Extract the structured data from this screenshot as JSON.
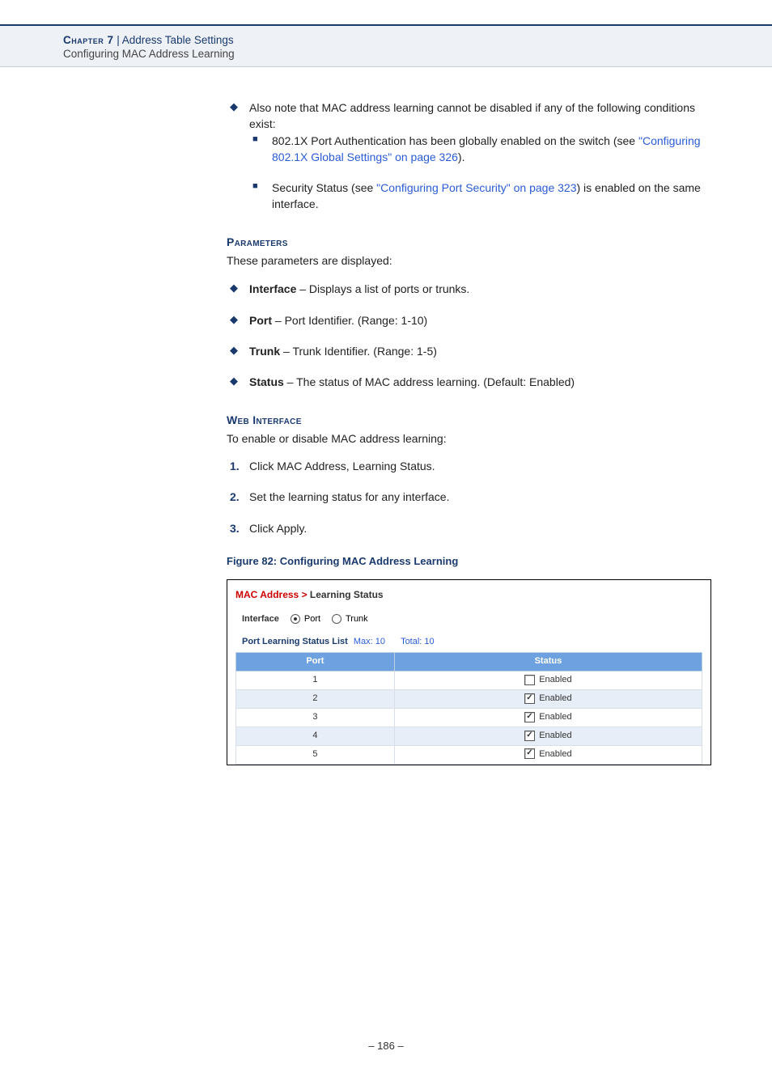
{
  "header": {
    "chapter_label": "Chapter 7",
    "sep": "  |  ",
    "title": "Address Table Settings",
    "subtitle": "Configuring MAC Address Learning"
  },
  "intro": {
    "note_lead": "Also note that MAC address learning cannot be disabled if any of the following conditions exist:",
    "cond1a": "802.1X Port Authentication has been globally enabled on the switch (see ",
    "cond1_link": "\"Configuring 802.1X Global Settings\" on page 326",
    "cond1b": ").",
    "cond2a": "Security Status (see ",
    "cond2_link": "\"Configuring Port Security\" on page 323",
    "cond2b": ") is enabled on the same interface."
  },
  "params": {
    "heading": "Parameters",
    "lead": "These parameters are displayed:",
    "items": [
      {
        "term": "Interface",
        "desc": " – Displays a list of ports or trunks."
      },
      {
        "term": "Port",
        "desc": " – Port Identifier. (Range: 1-10)"
      },
      {
        "term": "Trunk",
        "desc": " – Trunk Identifier. (Range: 1-5)"
      },
      {
        "term": "Status",
        "desc": " – The status of MAC address learning. (Default: Enabled)"
      }
    ]
  },
  "web": {
    "heading": "Web Interface",
    "lead": "To enable or disable MAC address learning:",
    "steps": [
      "Click MAC Address, Learning Status.",
      "Set the learning status for any interface.",
      "Click Apply."
    ]
  },
  "figure": {
    "caption": "Figure 82:  Configuring MAC Address Learning"
  },
  "ui": {
    "bc1": "MAC Address > ",
    "bc2": "Learning Status",
    "interface_label": "Interface",
    "radio_port": "Port",
    "radio_trunk": "Trunk",
    "list_title": "Port Learning Status List",
    "max_label": "Max: 10",
    "total_label": "Total: 10",
    "col_port": "Port",
    "col_status": "Status",
    "enabled_label": "Enabled",
    "rows": [
      {
        "port": "1",
        "checked": false
      },
      {
        "port": "2",
        "checked": true
      },
      {
        "port": "3",
        "checked": true
      },
      {
        "port": "4",
        "checked": true
      },
      {
        "port": "5",
        "checked": true
      }
    ]
  },
  "page_number": "– 186 –"
}
